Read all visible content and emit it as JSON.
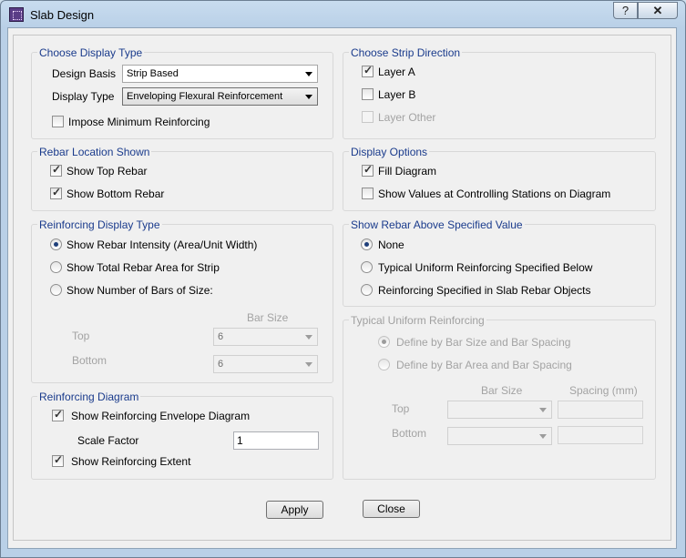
{
  "window": {
    "title": "Slab Design",
    "help_label": "?",
    "close_label": "✕"
  },
  "display_type": {
    "legend": "Choose Display Type",
    "design_basis_label": "Design Basis",
    "design_basis_value": "Strip Based",
    "display_type_label": "Display Type",
    "display_type_value": "Enveloping Flexural Reinforcement",
    "impose_min_label": "Impose Minimum Reinforcing"
  },
  "strip_direction": {
    "legend": "Choose Strip Direction",
    "layer_a": "Layer A",
    "layer_b": "Layer B",
    "layer_other": "Layer Other"
  },
  "rebar_location": {
    "legend": "Rebar Location Shown",
    "top": "Show Top Rebar",
    "bottom": "Show Bottom Rebar"
  },
  "display_options": {
    "legend": "Display Options",
    "fill": "Fill Diagram",
    "show_values": "Show Values at Controlling Stations on Diagram"
  },
  "reinforcing_display": {
    "legend": "Reinforcing Display Type",
    "intensity": "Show Rebar Intensity (Area/Unit Width)",
    "total_area": "Show Total Rebar Area for Strip",
    "num_bars": "Show Number of Bars of Size:",
    "bar_size_header": "Bar Size",
    "top_label": "Top",
    "top_value": "6",
    "bottom_label": "Bottom",
    "bottom_value": "6"
  },
  "show_rebar_above": {
    "legend": "Show Rebar Above Specified Value",
    "none": "None",
    "typical": "Typical Uniform Reinforcing Specified Below",
    "slab_objects": "Reinforcing Specified in Slab Rebar Objects"
  },
  "typical_uniform": {
    "legend": "Typical Uniform Reinforcing",
    "by_size_spacing": "Define by Bar Size and Bar Spacing",
    "by_area_spacing": "Define by Bar Area and Bar Spacing",
    "bar_size_header": "Bar Size",
    "spacing_header": "Spacing  (mm)",
    "top_label": "Top",
    "bottom_label": "Bottom"
  },
  "reinforcing_diagram": {
    "legend": "Reinforcing Diagram",
    "envelope": "Show Reinforcing Envelope Diagram",
    "scale_label": "Scale Factor",
    "scale_value": "1",
    "extent": "Show Reinforcing Extent"
  },
  "buttons": {
    "apply": "Apply",
    "close": "Close"
  }
}
